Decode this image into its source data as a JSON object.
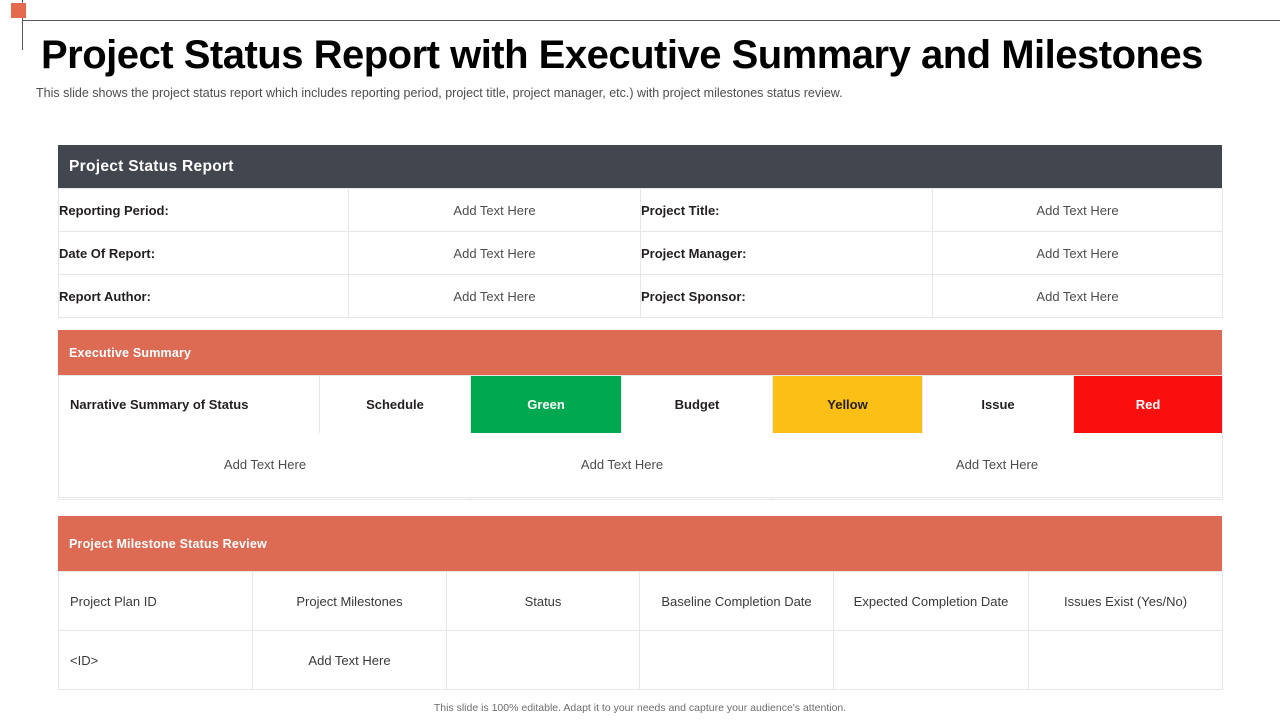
{
  "slide": {
    "title": "Project Status Report with Executive Summary and Milestones",
    "subtitle": "This slide shows the project status report which includes reporting period, project title, project manager, etc.) with project milestones status review.",
    "footer": "This slide is 100% editable. Adapt it to your needs and capture your audience's attention."
  },
  "colors": {
    "header_dark": "#41464f",
    "section_salmon": "#dd6a53",
    "corner_marker": "#e4694d",
    "status_green": "#00a94f",
    "status_yellow": "#fcbf15",
    "status_red": "#fa0f0f"
  },
  "status_report": {
    "section_title": "Project Status Report",
    "rows": [
      {
        "left_label": "Reporting Period:",
        "left_value": "Add Text Here",
        "right_label": "Project Title:",
        "right_value": "Add Text Here"
      },
      {
        "left_label": "Date Of Report:",
        "left_value": "Add Text Here",
        "right_label": "Project Manager:",
        "right_value": "Add Text Here"
      },
      {
        "left_label": "Report Author:",
        "left_value": "Add Text Here",
        "right_label": "Project Sponsor:",
        "right_value": "Add Text Here"
      }
    ]
  },
  "executive_summary": {
    "section_title": "Executive Summary",
    "header_cells": [
      {
        "label": "Narrative Summary of Status",
        "kind": "plain-left"
      },
      {
        "label": "Schedule",
        "kind": "plain"
      },
      {
        "label": "Green",
        "kind": "green"
      },
      {
        "label": "Budget",
        "kind": "plain"
      },
      {
        "label": "Yellow",
        "kind": "yellow"
      },
      {
        "label": "Issue",
        "kind": "plain"
      },
      {
        "label": "Red",
        "kind": "red"
      }
    ],
    "notes": [
      "Add Text Here",
      "Add Text Here",
      "Add Text Here"
    ]
  },
  "milestones": {
    "section_title": "Project Milestone Status Review",
    "columns": [
      "Project Plan ID",
      "Project Milestones",
      "Status",
      "Baseline Completion Date",
      "Expected Completion Date",
      "Issues Exist (Yes/No)"
    ],
    "rows": [
      [
        "<ID>",
        "Add Text Here",
        "",
        "",
        "",
        ""
      ]
    ]
  }
}
